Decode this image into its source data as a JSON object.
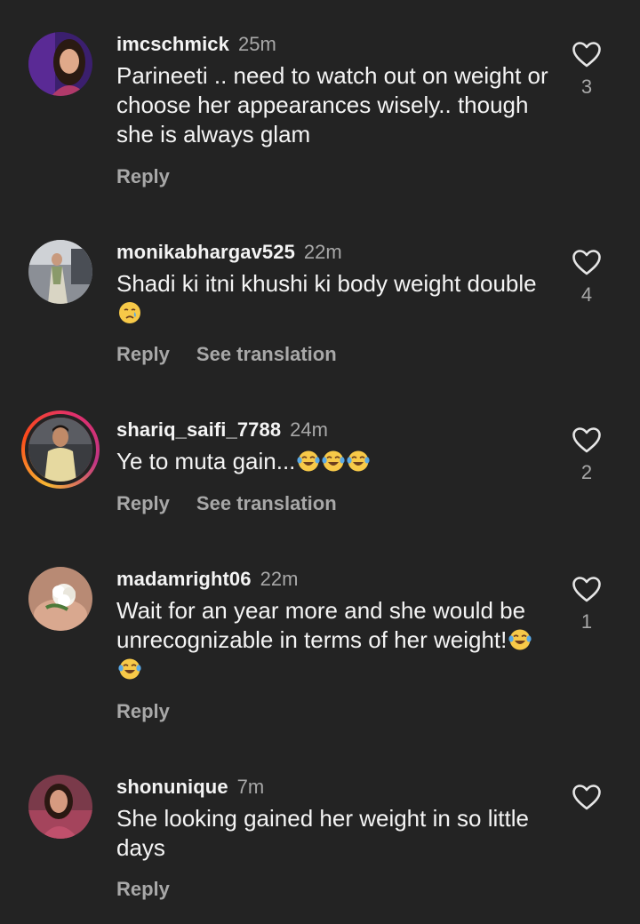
{
  "comments": [
    {
      "username": "imcschmick",
      "time": "25m",
      "text": "Parineeti .. need to watch out on weight or choose her appearances wisely.. though she is always glam",
      "reply_label": "Reply",
      "likes": "3"
    },
    {
      "username": "monikabhargav525",
      "time": "22m",
      "text": "Shadi ki itni khushi ki body weight double",
      "emojis": [
        "crying-face"
      ],
      "reply_label": "Reply",
      "translate_label": "See translation",
      "likes": "4"
    },
    {
      "username": "shariq_saifi_7788",
      "time": "24m",
      "text": "Ye to muta gain...",
      "emojis": [
        "tears-of-joy",
        "tears-of-joy",
        "tears-of-joy"
      ],
      "reply_label": "Reply",
      "translate_label": "See translation",
      "likes": "2"
    },
    {
      "username": "madamright06",
      "time": "22m",
      "text": "Wait for an year more and she would be unrecognizable in terms of her weight!",
      "emojis": [
        "tears-of-joy",
        "tears-of-joy"
      ],
      "reply_label": "Reply",
      "likes": "1"
    },
    {
      "username": "shonunique",
      "time": "7m",
      "text": "She looking  gained her weight in so little days",
      "reply_label": "Reply",
      "likes": ""
    }
  ],
  "icons": {
    "like": "heart-outline-icon",
    "laugh": "tears-of-joy-emoji",
    "cry": "crying-face-emoji"
  },
  "colors": {
    "background": "#232323",
    "primary_text": "#f4f4f4",
    "secondary_text": "#a8a8a8",
    "story_ring_start": "#f7b733",
    "story_ring_end": "#c13584"
  }
}
